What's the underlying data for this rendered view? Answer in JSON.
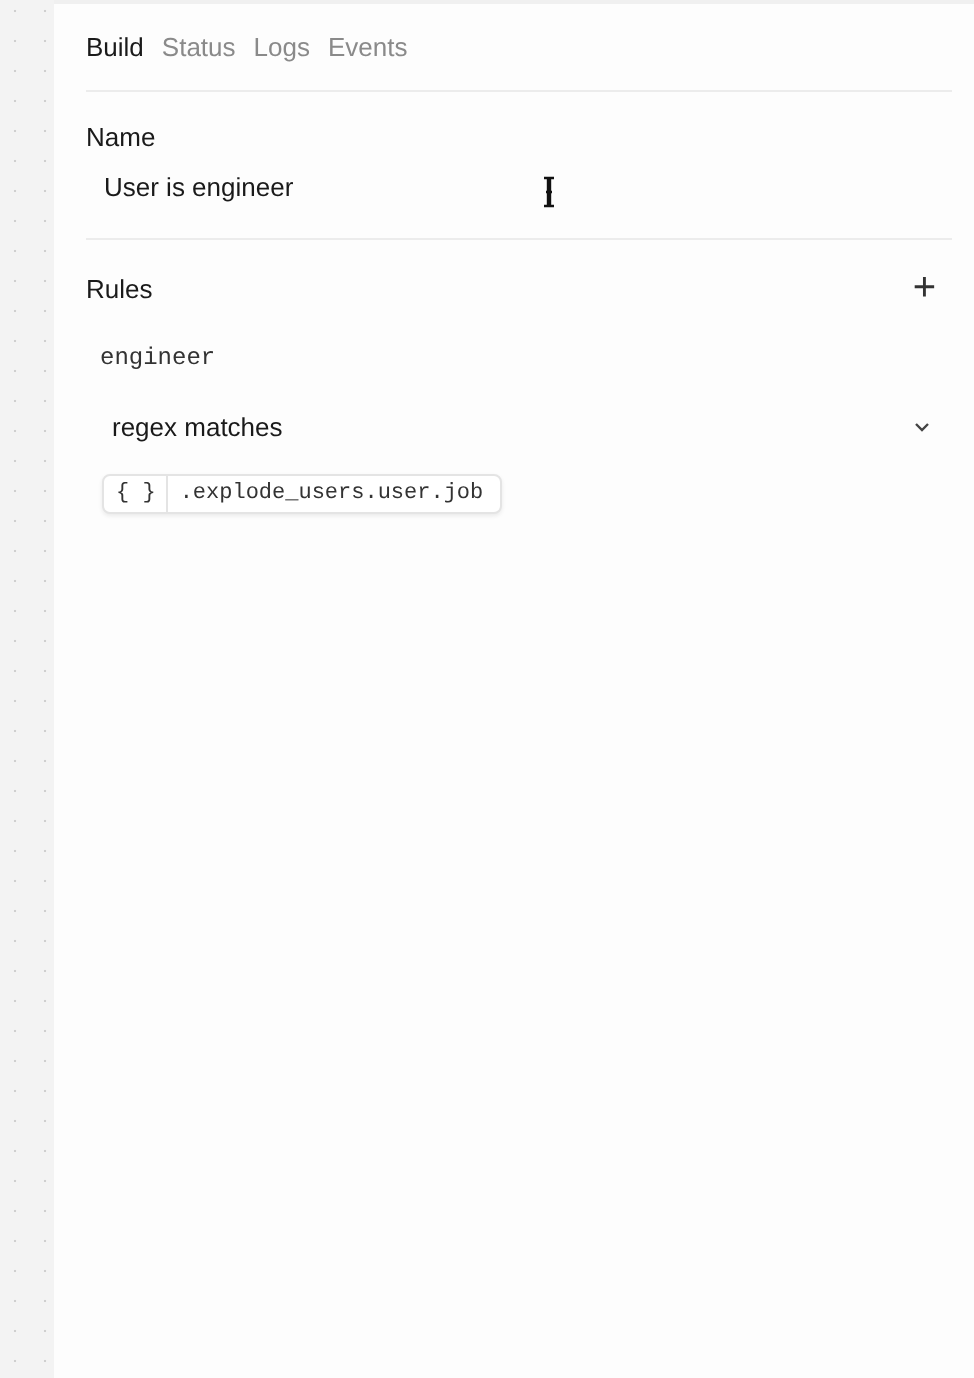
{
  "tabs": [
    {
      "label": "Build",
      "selected": true
    },
    {
      "label": "Status",
      "selected": false
    },
    {
      "label": "Logs",
      "selected": false
    },
    {
      "label": "Events",
      "selected": false
    }
  ],
  "name": {
    "label": "Name",
    "value": "User is engineer"
  },
  "rules": {
    "title": "Rules",
    "add": "+",
    "items": [
      {
        "name": "engineer",
        "operator": "regex matches",
        "reference_icon": "{ }",
        "reference": ".explode_users.user.job"
      }
    ]
  }
}
